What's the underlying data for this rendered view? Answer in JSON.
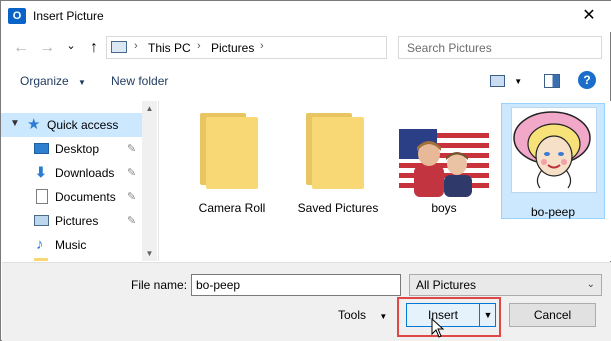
{
  "window": {
    "title": "Insert Picture",
    "app_icon": "outlook-icon",
    "close_label": "✕"
  },
  "nav": {
    "back": "←",
    "forward": "→",
    "recent": "⌄",
    "up": "↑"
  },
  "address": {
    "segments": [
      "This PC",
      "Pictures"
    ],
    "separator": "›",
    "dropdown": "⌄",
    "refresh": "↻"
  },
  "search": {
    "placeholder": "Search Pictures"
  },
  "toolbar": {
    "organize": "Organize",
    "new_folder": "New folder",
    "help": "?"
  },
  "sidebar": {
    "items": [
      {
        "label": "Quick access",
        "icon": "star-icon",
        "pinned": false,
        "selected": true
      },
      {
        "label": "Desktop",
        "icon": "desktop-icon",
        "pinned": true,
        "selected": false
      },
      {
        "label": "Downloads",
        "icon": "download-icon",
        "pinned": true,
        "selected": false
      },
      {
        "label": "Documents",
        "icon": "document-icon",
        "pinned": true,
        "selected": false
      },
      {
        "label": "Pictures",
        "icon": "pictures-icon",
        "pinned": true,
        "selected": false
      },
      {
        "label": "Music",
        "icon": "music-icon",
        "pinned": false,
        "selected": false
      }
    ],
    "pin_glyph": "📌"
  },
  "files": [
    {
      "name": "Camera Roll",
      "type": "folder",
      "selected": false
    },
    {
      "name": "Saved Pictures",
      "type": "folder",
      "selected": false
    },
    {
      "name": "boys",
      "type": "image",
      "selected": false
    },
    {
      "name": "bo-peep",
      "type": "image",
      "selected": true
    }
  ],
  "footer": {
    "filename_label": "File name:",
    "filename_value": "bo-peep",
    "filetype_value": "All Pictures",
    "tools_label": "Tools",
    "insert_label": "Insert",
    "cancel_label": "Cancel"
  },
  "colors": {
    "selection": "#cce8ff",
    "highlight_box": "#e04848",
    "folder": "#f8d775"
  }
}
